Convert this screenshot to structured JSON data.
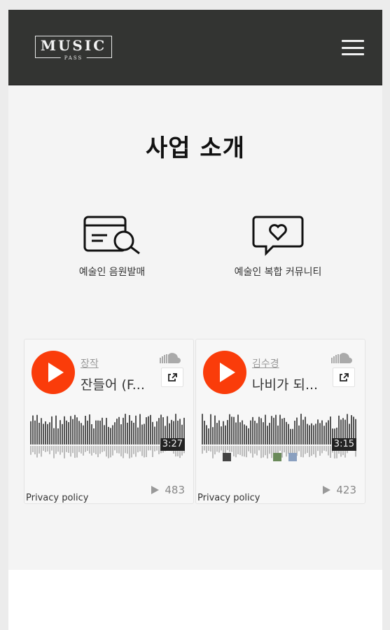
{
  "header": {
    "logo_main": "MUSIC",
    "logo_sub": "PASS"
  },
  "page": {
    "title": "사업 소개"
  },
  "features": [
    {
      "label": "예술인 음원발매",
      "icon": "card-search-icon"
    },
    {
      "label": "예술인 복합 커뮤니티",
      "icon": "heart-chat-icon"
    }
  ],
  "players": [
    {
      "artist": "장작",
      "track": "잔들어 (F...",
      "duration": "3:27",
      "plays": "483",
      "privacy": "Privacy policy"
    },
    {
      "artist": "김수경",
      "track": "나비가 되...",
      "duration": "3:15",
      "plays": "423",
      "privacy": "Privacy policy"
    }
  ],
  "colors": {
    "header_bg": "#333432",
    "play_button": "#fa3c0a",
    "page_bg": "#f4f4f4"
  }
}
